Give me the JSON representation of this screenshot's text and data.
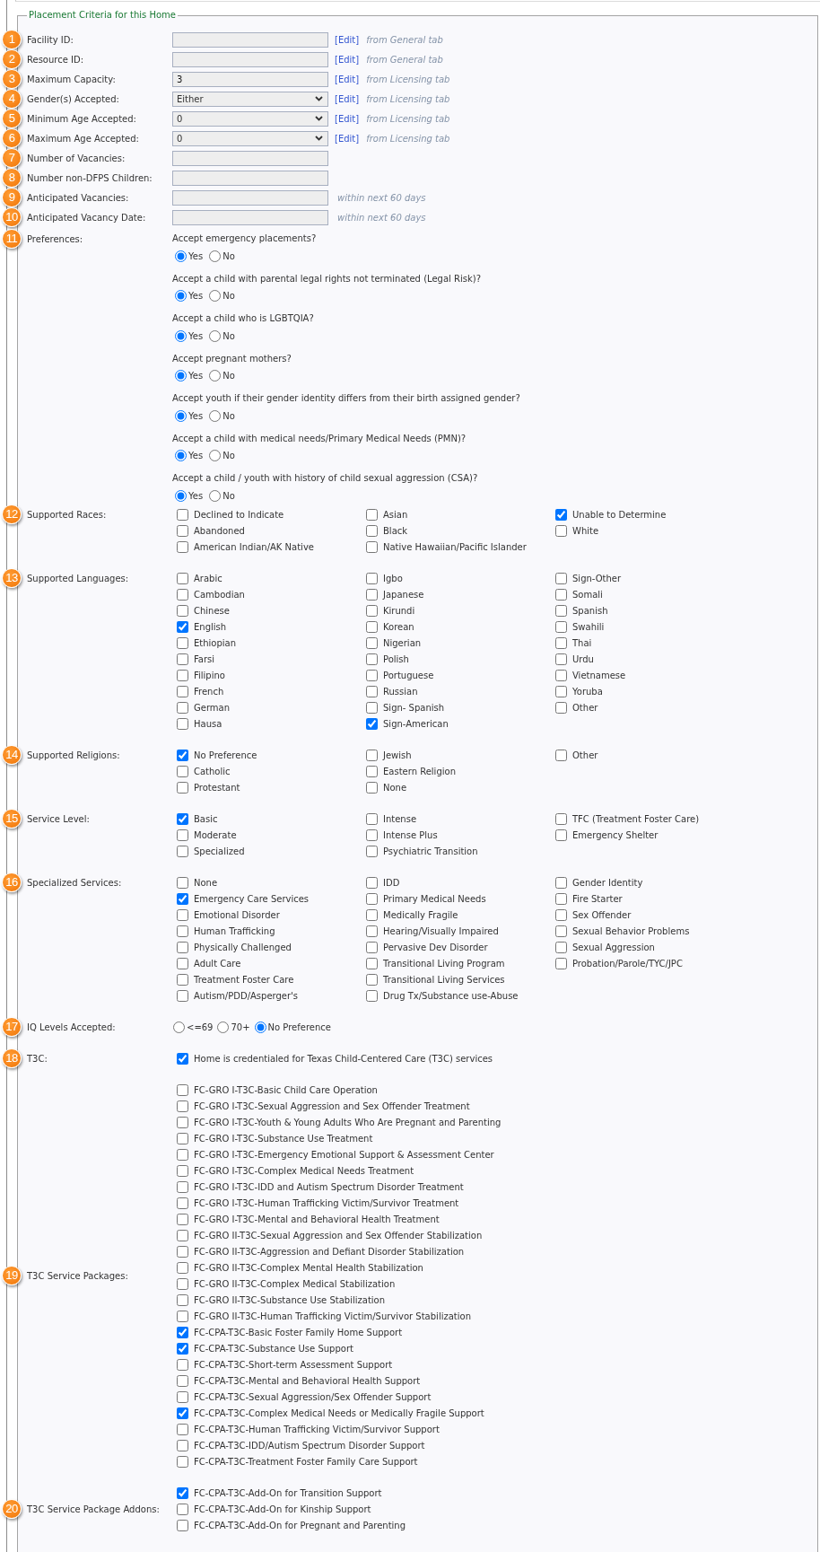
{
  "legend": "Placement Criteria for this Home",
  "sections": [
    {
      "badge": "1",
      "label": "Facility ID:",
      "kind": "text",
      "edit": "[Edit]",
      "note": "from General tab"
    },
    {
      "badge": "2",
      "label": "Resource ID:",
      "kind": "text",
      "edit": "[Edit]",
      "note": "from General tab"
    },
    {
      "badge": "3",
      "label": "Maximum Capacity:",
      "kind": "text",
      "value": "3",
      "edit": "[Edit]",
      "note": "from Licensing tab"
    },
    {
      "badge": "4",
      "label": "Gender(s) Accepted:",
      "kind": "select",
      "value": "Either",
      "edit": "[Edit]",
      "note": "from Licensing tab"
    },
    {
      "badge": "5",
      "label": "Minimum Age Accepted:",
      "kind": "select",
      "value": "0",
      "edit": "[Edit]",
      "note": "from Licensing tab"
    },
    {
      "badge": "6",
      "label": "Maximum Age Accepted:",
      "kind": "select",
      "value": "0",
      "edit": "[Edit]",
      "note": "from Licensing tab"
    },
    {
      "badge": "7",
      "label": "Number of Vacancies:",
      "kind": "text"
    },
    {
      "badge": "8",
      "label": "Number non-DFPS Children:",
      "kind": "text"
    },
    {
      "badge": "9",
      "label": "Anticipated Vacancies:",
      "kind": "text",
      "note": "within next 60 days"
    },
    {
      "badge": "10",
      "label": "Anticipated Vacancy Date:",
      "kind": "text",
      "note": "within next 60 days"
    },
    {
      "badge": "11",
      "label": "Preferences:",
      "kind": "questions",
      "questions": [
        {
          "text": "Accept emergency placements?",
          "options": [
            {
              "label": "Yes",
              "selected": true
            },
            {
              "label": "No",
              "selected": false
            }
          ]
        },
        {
          "text": "Accept a child with parental legal rights not terminated (Legal Risk)?",
          "options": [
            {
              "label": "Yes",
              "selected": true
            },
            {
              "label": "No",
              "selected": false
            }
          ]
        },
        {
          "text": "Accept a child who is LGBTQIA?",
          "options": [
            {
              "label": "Yes",
              "selected": true
            },
            {
              "label": "No",
              "selected": false
            }
          ]
        },
        {
          "text": "Accept pregnant mothers?",
          "options": [
            {
              "label": "Yes",
              "selected": true
            },
            {
              "label": "No",
              "selected": false
            }
          ]
        },
        {
          "text": "Accept youth if their gender identity differs from their birth assigned gender?",
          "options": [
            {
              "label": "Yes",
              "selected": true
            },
            {
              "label": "No",
              "selected": false
            }
          ]
        },
        {
          "text": "Accept a child with medical needs/Primary Medical Needs (PMN)?",
          "options": [
            {
              "label": "Yes",
              "selected": true
            },
            {
              "label": "No",
              "selected": false
            }
          ]
        },
        {
          "text": "Accept a child / youth with history of child sexual aggression (CSA)?",
          "options": [
            {
              "label": "Yes",
              "selected": true
            },
            {
              "label": "No",
              "selected": false
            }
          ]
        }
      ]
    },
    {
      "badge": "12",
      "label": "Supported Races:",
      "kind": "grid",
      "columns": [
        [
          {
            "label": "Declined to Indicate",
            "checked": false
          },
          {
            "label": "Abandoned",
            "checked": false
          },
          {
            "label": "American Indian/AK Native",
            "checked": false
          }
        ],
        [
          {
            "label": "Asian",
            "checked": false
          },
          {
            "label": "Black",
            "checked": false
          },
          {
            "label": "Native Hawaiian/Pacific Islander",
            "checked": false
          }
        ],
        [
          {
            "label": "Unable to Determine",
            "checked": true
          },
          {
            "label": "White",
            "checked": false
          }
        ]
      ]
    },
    {
      "badge": "13",
      "label": "Supported Languages:",
      "kind": "grid",
      "columns": [
        [
          {
            "label": "Arabic",
            "checked": false
          },
          {
            "label": "Cambodian",
            "checked": false
          },
          {
            "label": "Chinese",
            "checked": false
          },
          {
            "label": "English",
            "checked": true
          },
          {
            "label": "Ethiopian",
            "checked": false
          },
          {
            "label": "Farsi",
            "checked": false
          },
          {
            "label": "Filipino",
            "checked": false
          },
          {
            "label": "French",
            "checked": false
          },
          {
            "label": "German",
            "checked": false
          },
          {
            "label": "Hausa",
            "checked": false
          }
        ],
        [
          {
            "label": "Igbo",
            "checked": false
          },
          {
            "label": "Japanese",
            "checked": false
          },
          {
            "label": "Kirundi",
            "checked": false
          },
          {
            "label": "Korean",
            "checked": false
          },
          {
            "label": "Nigerian",
            "checked": false
          },
          {
            "label": "Polish",
            "checked": false
          },
          {
            "label": "Portuguese",
            "checked": false
          },
          {
            "label": "Russian",
            "checked": false
          },
          {
            "label": "Sign- Spanish",
            "checked": false
          },
          {
            "label": "Sign-American",
            "checked": true
          }
        ],
        [
          {
            "label": "Sign-Other",
            "checked": false
          },
          {
            "label": "Somali",
            "checked": false
          },
          {
            "label": "Spanish",
            "checked": false
          },
          {
            "label": "Swahili",
            "checked": false
          },
          {
            "label": "Thai",
            "checked": false
          },
          {
            "label": "Urdu",
            "checked": false
          },
          {
            "label": "Vietnamese",
            "checked": false
          },
          {
            "label": "Yoruba",
            "checked": false
          },
          {
            "label": "Other",
            "checked": false
          }
        ]
      ]
    },
    {
      "badge": "14",
      "label": "Supported Religions:",
      "kind": "grid",
      "columns": [
        [
          {
            "label": "No Preference",
            "checked": true
          },
          {
            "label": "Catholic",
            "checked": false
          },
          {
            "label": "Protestant",
            "checked": false
          }
        ],
        [
          {
            "label": "Jewish",
            "checked": false
          },
          {
            "label": "Eastern Religion",
            "checked": false
          },
          {
            "label": "None",
            "checked": false
          }
        ],
        [
          {
            "label": "Other",
            "checked": false
          }
        ]
      ]
    },
    {
      "badge": "15",
      "label": "Service Level:",
      "kind": "grid",
      "columns": [
        [
          {
            "label": "Basic",
            "checked": true
          },
          {
            "label": "Moderate",
            "checked": false
          },
          {
            "label": "Specialized",
            "checked": false
          }
        ],
        [
          {
            "label": "Intense",
            "checked": false
          },
          {
            "label": "Intense Plus",
            "checked": false
          },
          {
            "label": "Psychiatric Transition",
            "checked": false
          }
        ],
        [
          {
            "label": "TFC (Treatment Foster Care)",
            "checked": false
          },
          {
            "label": "Emergency Shelter",
            "checked": false
          }
        ]
      ]
    },
    {
      "badge": "16",
      "label": "Specialized Services:",
      "kind": "grid",
      "columns": [
        [
          {
            "label": "None",
            "checked": false
          },
          {
            "label": "Emergency Care Services",
            "checked": true
          },
          {
            "label": "Emotional Disorder",
            "checked": false
          },
          {
            "label": "Human Trafficking",
            "checked": false
          },
          {
            "label": "Physically Challenged",
            "checked": false
          },
          {
            "label": "Adult Care",
            "checked": false
          },
          {
            "label": "Treatment Foster Care",
            "checked": false
          },
          {
            "label": "Autism/PDD/Asperger's",
            "checked": false
          }
        ],
        [
          {
            "label": "IDD",
            "checked": false
          },
          {
            "label": "Primary Medical Needs",
            "checked": false
          },
          {
            "label": "Medically Fragile",
            "checked": false
          },
          {
            "label": "Hearing/Visually Impaired",
            "checked": false
          },
          {
            "label": "Pervasive Dev Disorder",
            "checked": false
          },
          {
            "label": "Transitional Living Program",
            "checked": false
          },
          {
            "label": "Transitional Living Services",
            "checked": false
          },
          {
            "label": "Drug Tx/Substance use-Abuse",
            "checked": false
          }
        ],
        [
          {
            "label": "Gender Identity",
            "checked": false
          },
          {
            "label": "Fire Starter",
            "checked": false
          },
          {
            "label": "Sex Offender",
            "checked": false
          },
          {
            "label": "Sexual Behavior Problems",
            "checked": false
          },
          {
            "label": "Sexual Aggression",
            "checked": false
          },
          {
            "label": "Probation/Parole/TYC/JPC",
            "checked": false
          }
        ]
      ]
    },
    {
      "badge": "17",
      "label": "IQ Levels Accepted:",
      "kind": "radios",
      "options": [
        {
          "label": "<=69",
          "selected": false
        },
        {
          "label": "70+",
          "selected": false
        },
        {
          "label": "No Preference",
          "selected": true
        }
      ]
    },
    {
      "badge": "18",
      "label": "T3C:",
      "kind": "list",
      "items": [
        {
          "label": "Home is credentialed for Texas Child-Centered Care (T3C) services",
          "checked": true
        }
      ]
    },
    {
      "badge": "19",
      "label": "T3C Service Packages:",
      "kind": "list",
      "items": [
        {
          "label": "FC-GRO I-T3C-Basic Child Care Operation",
          "checked": false
        },
        {
          "label": "FC-GRO I-T3C-Sexual Aggression and Sex Offender Treatment",
          "checked": false
        },
        {
          "label": "FC-GRO I-T3C-Youth & Young Adults Who Are Pregnant and Parenting",
          "checked": false
        },
        {
          "label": "FC-GRO I-T3C-Substance Use Treatment",
          "checked": false
        },
        {
          "label": "FC-GRO I-T3C-Emergency Emotional Support & Assessment Center",
          "checked": false
        },
        {
          "label": "FC-GRO I-T3C-Complex Medical Needs Treatment",
          "checked": false
        },
        {
          "label": "FC-GRO I-T3C-IDD and Autism Spectrum Disorder Treatment",
          "checked": false
        },
        {
          "label": "FC-GRO I-T3C-Human Trafficking Victim/Survivor Treatment",
          "checked": false
        },
        {
          "label": "FC-GRO I-T3C-Mental and Behavioral Health Treatment",
          "checked": false
        },
        {
          "label": "FC-GRO II-T3C-Sexual Aggression and Sex Offender Stabilization",
          "checked": false
        },
        {
          "label": "FC-GRO II-T3C-Aggression and Defiant Disorder Stabilization",
          "checked": false
        },
        {
          "label": "FC-GRO II-T3C-Complex Mental Health Stabilization",
          "checked": false
        },
        {
          "label": "FC-GRO II-T3C-Complex Medical Stabilization",
          "checked": false
        },
        {
          "label": "FC-GRO II-T3C-Substance Use Stabilization",
          "checked": false
        },
        {
          "label": "FC-GRO II-T3C-Human Trafficking Victim/Survivor Stabilization",
          "checked": false
        },
        {
          "label": "FC-CPA-T3C-Basic Foster Family Home Support",
          "checked": true
        },
        {
          "label": "FC-CPA-T3C-Substance Use Support",
          "checked": true
        },
        {
          "label": "FC-CPA-T3C-Short-term Assessment Support",
          "checked": false
        },
        {
          "label": "FC-CPA-T3C-Mental and Behavioral Health Support",
          "checked": false
        },
        {
          "label": "FC-CPA-T3C-Sexual Aggression/Sex Offender Support",
          "checked": false
        },
        {
          "label": "FC-CPA-T3C-Complex Medical Needs or Medically Fragile Support",
          "checked": true
        },
        {
          "label": "FC-CPA-T3C-Human Trafficking Victim/Survivor Support",
          "checked": false
        },
        {
          "label": "FC-CPA-T3C-IDD/Autism Spectrum Disorder Support",
          "checked": false
        },
        {
          "label": "FC-CPA-T3C-Treatment Foster Family Care Support",
          "checked": false
        }
      ]
    },
    {
      "badge": "20",
      "label": "T3C Service Package Addons:",
      "kind": "list",
      "items": [
        {
          "label": "FC-CPA-T3C-Add-On for Transition Support",
          "checked": true
        },
        {
          "label": "FC-CPA-T3C-Add-On for Kinship Support",
          "checked": false
        },
        {
          "label": "FC-CPA-T3C-Add-On for Pregnant and Parenting",
          "checked": false
        }
      ]
    }
  ]
}
